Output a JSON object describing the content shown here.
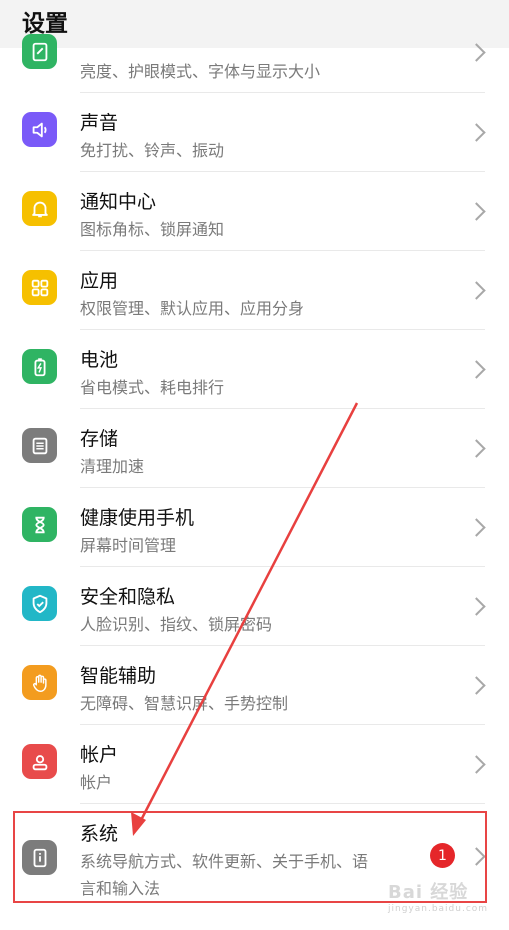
{
  "header": {
    "title": "设置"
  },
  "items": [
    {
      "title": "",
      "subtitle": "亮度、护眼模式、字体与显示大小",
      "icon": "display-icon",
      "color": "#2fb463"
    },
    {
      "title": "声音",
      "subtitle": "免打扰、铃声、振动",
      "icon": "speaker-icon",
      "color": "#7a5af8"
    },
    {
      "title": "通知中心",
      "subtitle": "图标角标、锁屏通知",
      "icon": "bell-icon",
      "color": "#f6c000"
    },
    {
      "title": "应用",
      "subtitle": "权限管理、默认应用、应用分身",
      "icon": "apps-grid-icon",
      "color": "#f6c000"
    },
    {
      "title": "电池",
      "subtitle": "省电模式、耗电排行",
      "icon": "battery-icon",
      "color": "#2fb463"
    },
    {
      "title": "存储",
      "subtitle": "清理加速",
      "icon": "storage-icon",
      "color": "#7c7c7c"
    },
    {
      "title": "健康使用手机",
      "subtitle": "屏幕时间管理",
      "icon": "hourglass-icon",
      "color": "#2fb463"
    },
    {
      "title": "安全和隐私",
      "subtitle": "人脸识别、指纹、锁屏密码",
      "icon": "shield-icon",
      "color": "#22b7c7"
    },
    {
      "title": "智能辅助",
      "subtitle": "无障碍、智慧识屏、手势控制",
      "icon": "hand-icon",
      "color": "#f39c1f"
    },
    {
      "title": "帐户",
      "subtitle": "帐户",
      "icon": "account-icon",
      "color": "#e84b4b"
    },
    {
      "title": "系统",
      "subtitle_line1": "系统导航方式、软件更新、关于手机、语",
      "subtitle_line2": "言和输入法",
      "icon": "phone-info-icon",
      "color": "#7c7c7c",
      "badge": "1"
    }
  ],
  "watermark": {
    "text": "Bai 经验",
    "sub": "jingyan.baidu.com"
  }
}
